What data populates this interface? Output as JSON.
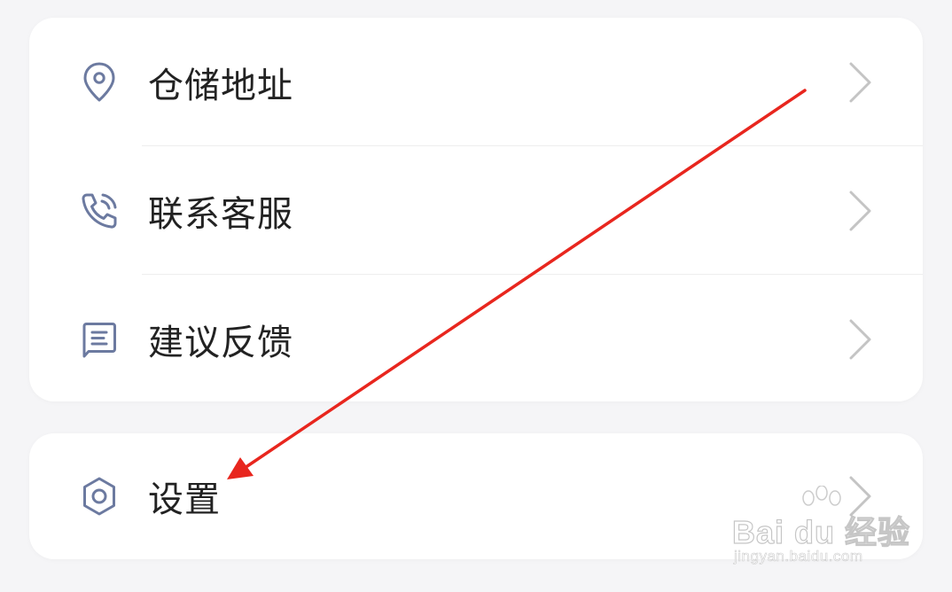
{
  "menu": {
    "items": [
      {
        "label": "仓储地址",
        "icon": "location-pin-icon"
      },
      {
        "label": "联系客服",
        "icon": "phone-icon"
      },
      {
        "label": "建议反馈",
        "icon": "feedback-icon"
      }
    ]
  },
  "settings": {
    "label": "设置",
    "icon": "gear-icon"
  },
  "watermark": {
    "brand": "Bai du 经验",
    "url": "jingyan.baidu.com"
  },
  "colors": {
    "icon": "#6c7aa0",
    "chevron": "#c4c4c4",
    "arrow": "#e8261e",
    "background": "#f5f5f7"
  }
}
